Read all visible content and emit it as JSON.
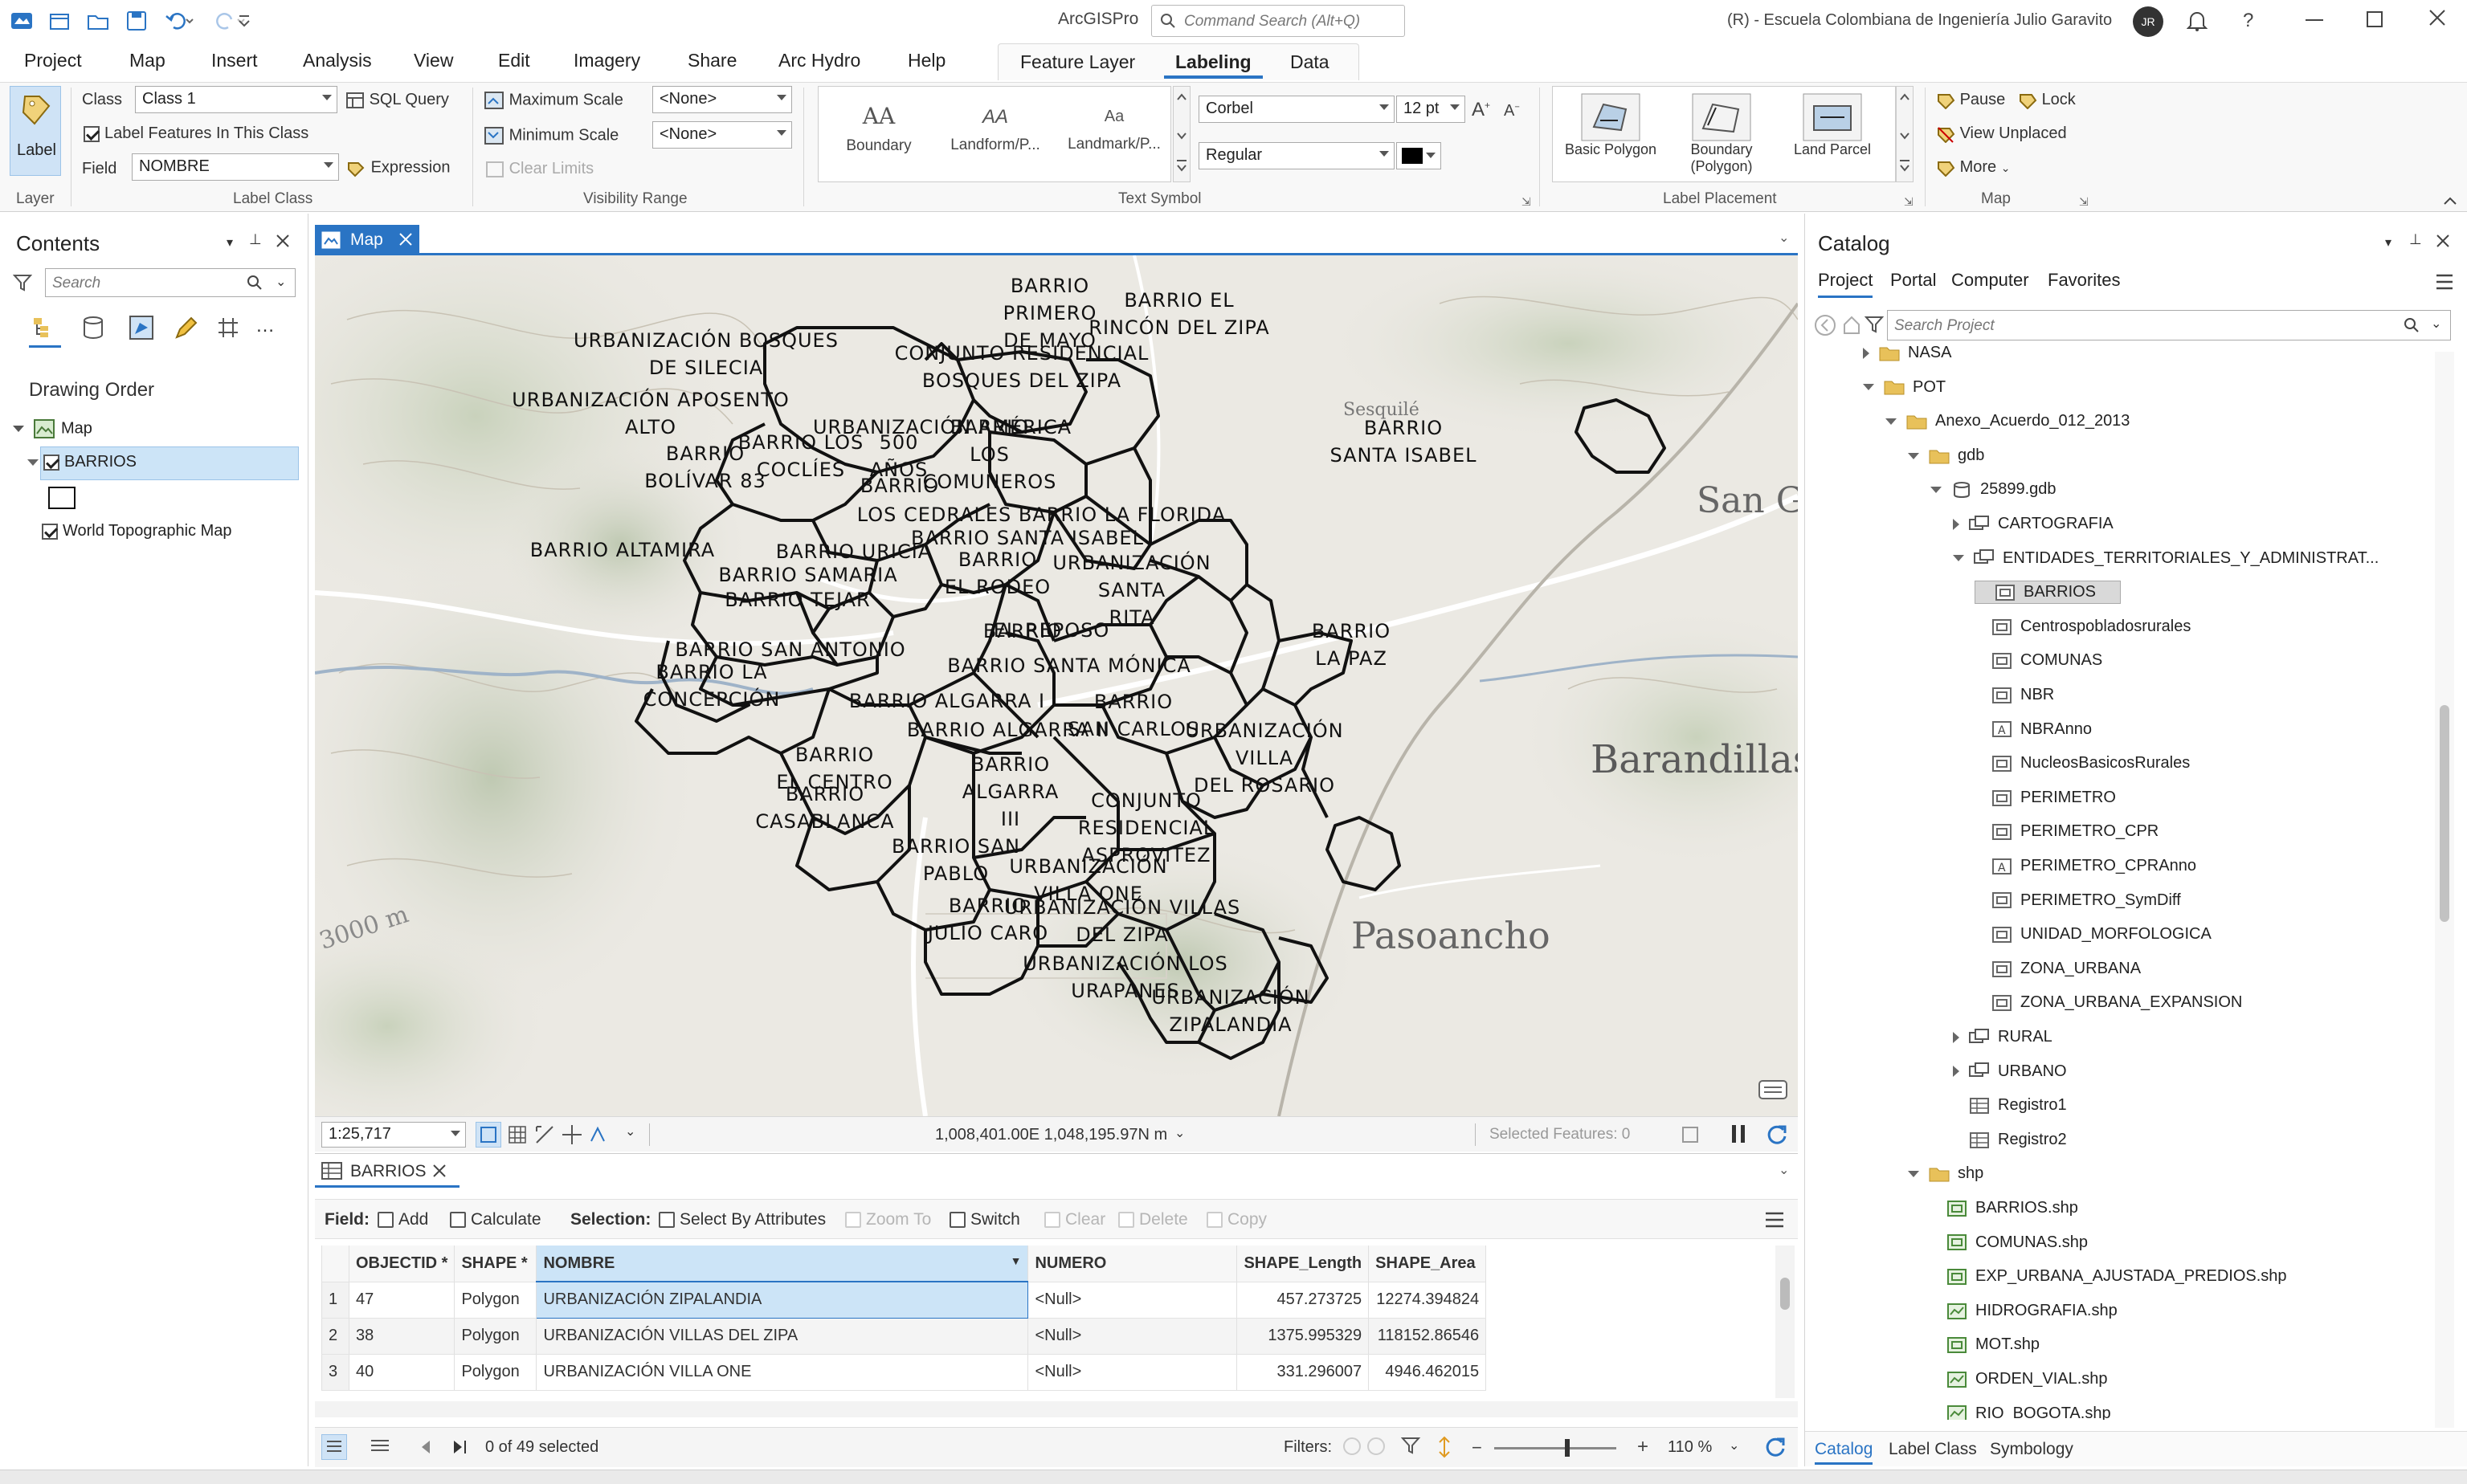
{
  "app": {
    "name": "ArcGISPro",
    "search_placeholder": "Command Search (Alt+Q)",
    "org": "(R) - Escuela Colombiana de Ingeniería Julio Garavito",
    "avatar": "JR"
  },
  "menu": [
    "Project",
    "Map",
    "Insert",
    "Analysis",
    "View",
    "Edit",
    "Imagery",
    "Share",
    "Arc Hydro",
    "Help"
  ],
  "context_tabs": [
    "Feature Layer",
    "Labeling",
    "Data"
  ],
  "ribbon": {
    "layer": {
      "label": "Label",
      "group": "Layer"
    },
    "label_class": {
      "class_label": "Class",
      "class_value": "Class 1",
      "sql": "SQL Query",
      "label_features": "Label Features In This Class",
      "field_label": "Field",
      "field_value": "NOMBRE",
      "expression": "Expression",
      "group": "Label Class"
    },
    "visibility": {
      "max": "Maximum Scale",
      "max_value": "<None>",
      "min": "Minimum Scale",
      "min_value": "<None>",
      "clear": "Clear Limits",
      "group": "Visibility Range"
    },
    "text_symbol": {
      "gallery": [
        "Boundary",
        "Landform/P...",
        "Landmark/P..."
      ],
      "gallery_glyph": [
        "AA",
        "AA",
        "Aa"
      ],
      "font": "Corbel",
      "size": "12 pt",
      "style": "Regular",
      "group": "Text Symbol"
    },
    "placement": {
      "items": [
        "Basic Polygon",
        "Boundary (Polygon)",
        "Land Parcel"
      ],
      "group": "Label Placement"
    },
    "map": {
      "pause": "Pause",
      "lock": "Lock",
      "view_unplaced": "View Unplaced",
      "more": "More",
      "group": "Map"
    }
  },
  "contents": {
    "title": "Contents",
    "search_placeholder": "Search",
    "drawing_order": "Drawing Order",
    "map": "Map",
    "layers": [
      "BARRIOS",
      "World Topographic Map"
    ]
  },
  "map_tab": "Map",
  "map_labels": [
    {
      "t": "BARRIO\nPRIMERO\nDE MAYO"
    },
    {
      "t": "BARRIO EL\nRINCÓN DEL ZIPA"
    },
    {
      "t": "URBANIZACIÓN BOSQUES\nDE SILECIA"
    },
    {
      "t": "CONJUNTO RESIDENCIAL\nBOSQUES DEL ZIPA"
    },
    {
      "t": "URBANIZACIÓN APOSENTO\nALTO"
    },
    {
      "t": "URBANIZACIÓN AMÉRICA"
    },
    {
      "t": "BARRIO\nLOS\nCOMUNEROS"
    },
    {
      "t": "BARRIO\nSANTA ISABEL"
    },
    {
      "t": "BARRIO LOS\nCOCLÍES"
    },
    {
      "t": "500\nAÑOS"
    },
    {
      "t": "BARRIO\nBOLÍVAR 83"
    },
    {
      "t": "BARRIO"
    },
    {
      "t": "BARRIO LA FLORIDA"
    },
    {
      "t": "LOS CEDRALES"
    },
    {
      "t": "BARRIO SANTA ISABEL"
    },
    {
      "t": "BARRIO ALTAMIRA"
    },
    {
      "t": "BARRIO URICIA"
    },
    {
      "t": "BARRIO\nEL RODEO"
    },
    {
      "t": "URBANIZACIÓN\nSANTA\nRITA"
    },
    {
      "t": "BARRIO SAMARIA"
    },
    {
      "t": "BARRIO TEJAR"
    },
    {
      "t": "BARRIO"
    },
    {
      "t": "EL REPOSO"
    },
    {
      "t": "BARRIO\nLA PAZ"
    },
    {
      "t": "BARRIO SAN ANTONIO"
    },
    {
      "t": "BARRIO LA\nCONCEPCIÓN"
    },
    {
      "t": "BARRIO SANTA MÓNICA"
    },
    {
      "t": "BARRIO\nSAN CARLOS"
    },
    {
      "t": "URBANIZACIÓN\nVILLA\nDEL ROSARIO"
    },
    {
      "t": "BARRIO ALGARRA I"
    },
    {
      "t": "BARRIO ALGARRA II"
    },
    {
      "t": "BARRIO\nEL CENTRO"
    },
    {
      "t": "BARRIO\nALGARRA\nIII"
    },
    {
      "t": "BARRIO\nCASABLANCA"
    },
    {
      "t": "CONJUNTO\nRESIDENCIAL\nASPROVITEZ"
    },
    {
      "t": "BARRIO SAN\nPABLO"
    },
    {
      "t": "URBANIZACIÓN\nVILLA ONE"
    },
    {
      "t": "BARRIO\nJULIO CARO"
    },
    {
      "t": "URBANIZACIÓN VILLAS\nDEL ZIPA"
    },
    {
      "t": "URBANIZACIÓN LOS\nURAPANES"
    },
    {
      "t": "URBANIZACIÓN\nZIPALANDIA"
    }
  ],
  "map_places": [
    "San Gabr",
    "Barandillas",
    "Pasoancho",
    "Sesquilé",
    "3000 m"
  ],
  "map_status": {
    "scale": "1:25,717",
    "coords": "1,008,401.00E 1,048,195.97N m",
    "selected": "Selected Features: 0"
  },
  "table": {
    "tab": "BARRIOS",
    "field_label": "Field:",
    "add": "Add",
    "calculate": "Calculate",
    "selection_label": "Selection:",
    "select_by_attr": "Select By Attributes",
    "zoom_to": "Zoom To",
    "switch": "Switch",
    "clear": "Clear",
    "delete": "Delete",
    "copy": "Copy",
    "columns": [
      "OBJECTID *",
      "SHAPE *",
      "NOMBRE",
      "NUMERO",
      "SHAPE_Length",
      "SHAPE_Area"
    ],
    "rows": [
      [
        "1",
        "47",
        "Polygon",
        "URBANIZACIÓN ZIPALANDIA",
        "<Null>",
        "457.273725",
        "12274.394824"
      ],
      [
        "2",
        "38",
        "Polygon",
        "URBANIZACIÓN VILLAS DEL ZIPA",
        "<Null>",
        "1375.995329",
        "118152.86546"
      ],
      [
        "3",
        "40",
        "Polygon",
        "URBANIZACIÓN VILLA ONE",
        "<Null>",
        "331.296007",
        "4946.462015"
      ]
    ],
    "selected": "0 of 49 selected",
    "filters": "Filters:",
    "zoom": "110 %"
  },
  "catalog": {
    "title": "Catalog",
    "tabs": [
      "Project",
      "Portal",
      "Computer",
      "Favorites"
    ],
    "search_placeholder": "Search Project",
    "items": [
      {
        "label": "NASA",
        "type": "folder",
        "indent": 0,
        "exp": "right"
      },
      {
        "label": "POT",
        "type": "folder",
        "indent": 0,
        "exp": "down"
      },
      {
        "label": "Anexo_Acuerdo_012_2013",
        "type": "folder",
        "indent": 1,
        "exp": "down"
      },
      {
        "label": "gdb",
        "type": "folder",
        "indent": 2,
        "exp": "down"
      },
      {
        "label": "25899.gdb",
        "type": "gdb",
        "indent": 3,
        "exp": "down"
      },
      {
        "label": "CARTOGRAFIA",
        "type": "dataset",
        "indent": 4,
        "exp": "right"
      },
      {
        "label": "ENTIDADES_TERRITORIALES_Y_ADMINISTRAT...",
        "type": "dataset",
        "indent": 4,
        "exp": "down"
      },
      {
        "label": "BARRIOS",
        "type": "fc",
        "indent": 5,
        "exp": "",
        "sel": true
      },
      {
        "label": "Centrospobladosrurales",
        "type": "fc",
        "indent": 5,
        "exp": ""
      },
      {
        "label": "COMUNAS",
        "type": "fc",
        "indent": 5,
        "exp": ""
      },
      {
        "label": "NBR",
        "type": "fc",
        "indent": 5,
        "exp": ""
      },
      {
        "label": "NBRAnno",
        "type": "anno",
        "indent": 5,
        "exp": ""
      },
      {
        "label": "NucleosBasicosRurales",
        "type": "fc",
        "indent": 5,
        "exp": ""
      },
      {
        "label": "PERIMETRO",
        "type": "fc",
        "indent": 5,
        "exp": ""
      },
      {
        "label": "PERIMETRO_CPR",
        "type": "fc",
        "indent": 5,
        "exp": ""
      },
      {
        "label": "PERIMETRO_CPRAnno",
        "type": "anno",
        "indent": 5,
        "exp": ""
      },
      {
        "label": "PERIMETRO_SymDiff",
        "type": "fc",
        "indent": 5,
        "exp": ""
      },
      {
        "label": "UNIDAD_MORFOLOGICA",
        "type": "fc",
        "indent": 5,
        "exp": ""
      },
      {
        "label": "ZONA_URBANA",
        "type": "fc",
        "indent": 5,
        "exp": ""
      },
      {
        "label": "ZONA_URBANA_EXPANSION",
        "type": "fc",
        "indent": 5,
        "exp": ""
      },
      {
        "label": "RURAL",
        "type": "dataset",
        "indent": 4,
        "exp": "right"
      },
      {
        "label": "URBANO",
        "type": "dataset",
        "indent": 4,
        "exp": "right"
      },
      {
        "label": "Registro1",
        "type": "table",
        "indent": 4,
        "exp": ""
      },
      {
        "label": "Registro2",
        "type": "table",
        "indent": 4,
        "exp": ""
      },
      {
        "label": "shp",
        "type": "folder",
        "indent": 2,
        "exp": "down"
      },
      {
        "label": "BARRIOS.shp",
        "type": "shp",
        "indent": 3,
        "exp": ""
      },
      {
        "label": "COMUNAS.shp",
        "type": "shp",
        "indent": 3,
        "exp": ""
      },
      {
        "label": "EXP_URBANA_AJUSTADA_PREDIOS.shp",
        "type": "shp",
        "indent": 3,
        "exp": ""
      },
      {
        "label": "HIDROGRAFIA.shp",
        "type": "shpl",
        "indent": 3,
        "exp": ""
      },
      {
        "label": "MOT.shp",
        "type": "shp",
        "indent": 3,
        "exp": ""
      },
      {
        "label": "ORDEN_VIAL.shp",
        "type": "shpl",
        "indent": 3,
        "exp": ""
      },
      {
        "label": "RIO_BOGOTA.shp",
        "type": "shpl",
        "indent": 3,
        "exp": ""
      }
    ],
    "bottom_tabs": [
      "Catalog",
      "Label Class",
      "Symbology"
    ]
  },
  "colors": {
    "accent": "#2a74c4",
    "selection": "#cce4f7",
    "map_bg": "#e9e6e0"
  }
}
